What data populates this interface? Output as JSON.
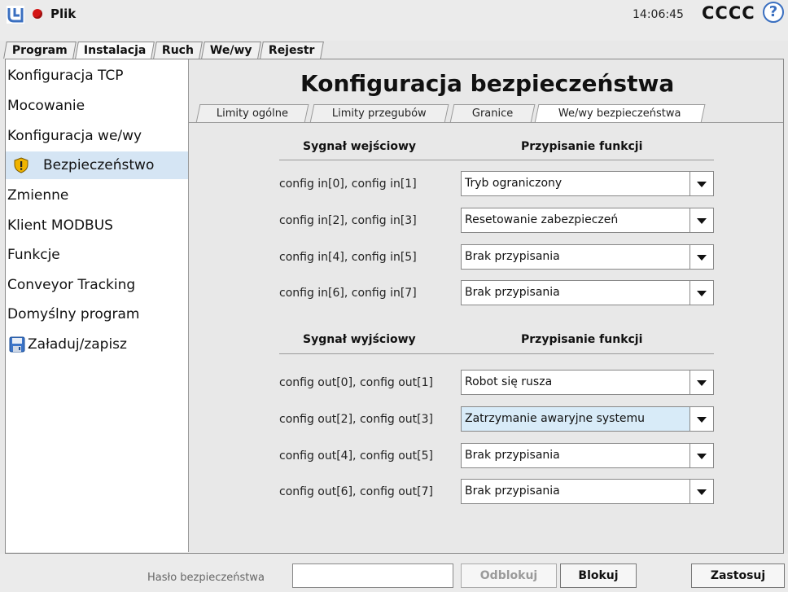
{
  "app": {
    "menu": "Plik",
    "clock": "14:06:45",
    "robot_name": "CCCC",
    "help": "?"
  },
  "main_tabs": [
    "Program",
    "Instalacja",
    "Ruch",
    "We/wy",
    "Rejestr"
  ],
  "sidebar": {
    "items": [
      {
        "label": "Konfiguracja TCP"
      },
      {
        "label": "Mocowanie"
      },
      {
        "label": "Konfiguracja we/wy"
      },
      {
        "label": "Bezpieczeństwo"
      },
      {
        "label": "Zmienne"
      },
      {
        "label": "Klient MODBUS"
      },
      {
        "label": "Funkcje"
      },
      {
        "label": "Conveyor Tracking"
      },
      {
        "label": "Domyślny program"
      },
      {
        "label": "Załaduj/zapisz"
      }
    ]
  },
  "main": {
    "title": "Konfiguracja bezpieczeństwa",
    "subtabs": [
      "Limity ogólne",
      "Limity przegubów",
      "Granice",
      "We/wy bezpieczeństwa"
    ],
    "input_section": {
      "signal_header": "Sygnał wejściowy",
      "function_header": "Przypisanie funkcji",
      "rows": [
        {
          "signal": "config in[0], config in[1]",
          "function": "Tryb ograniczony"
        },
        {
          "signal": "config in[2], config in[3]",
          "function": "Resetowanie zabezpieczeń"
        },
        {
          "signal": "config in[4], config in[5]",
          "function": "Brak przypisania"
        },
        {
          "signal": "config in[6], config in[7]",
          "function": "Brak przypisania"
        }
      ]
    },
    "output_section": {
      "signal_header": "Sygnał wyjściowy",
      "function_header": "Przypisanie funkcji",
      "rows": [
        {
          "signal": "config out[0], config out[1]",
          "function": "Robot się rusza"
        },
        {
          "signal": "config out[2], config out[3]",
          "function": "Zatrzymanie awaryjne systemu"
        },
        {
          "signal": "config out[4], config out[5]",
          "function": "Brak przypisania"
        },
        {
          "signal": "config out[6], config out[7]",
          "function": "Brak przypisania"
        }
      ]
    }
  },
  "bottom": {
    "password_label": "Hasło bezpieczeństwa",
    "password_value": "",
    "unlock": "Odblokuj",
    "lock": "Blokuj",
    "apply": "Zastosuj"
  }
}
